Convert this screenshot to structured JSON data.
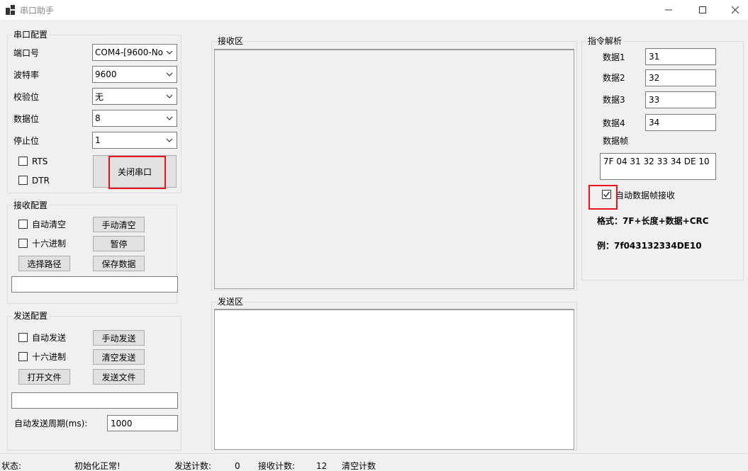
{
  "window": {
    "title": "串口助手",
    "app_icon": "app-grid-icon"
  },
  "serial_config": {
    "title": "串口配置",
    "port_label": "端口号",
    "port_value": "COM4-[9600-No",
    "baud_label": "波特率",
    "baud_value": "9600",
    "parity_label": "校验位",
    "parity_value": "无",
    "databits_label": "数据位",
    "databits_value": "8",
    "stopbits_label": "停止位",
    "stopbits_value": "1",
    "rts_label": "RTS",
    "dtr_label": "DTR",
    "close_port_label": "关闭串口"
  },
  "receive_config": {
    "title": "接收配置",
    "auto_clear_label": "自动清空",
    "manual_clear_label": "手动清空",
    "hex_label": "十六进制",
    "pause_label": "暂停",
    "select_path_label": "选择路径",
    "save_data_label": "保存数据",
    "path_value": ""
  },
  "send_config": {
    "title": "发送配置",
    "auto_send_label": "自动发送",
    "manual_send_label": "手动发送",
    "hex_label": "十六进制",
    "clear_send_label": "清空发送",
    "open_file_label": "打开文件",
    "send_file_label": "发送文件",
    "file_value": "",
    "period_label": "自动发送周期(ms):",
    "period_value": "1000"
  },
  "receive_area": {
    "title": "接收区",
    "content": ""
  },
  "send_area": {
    "title": "发送区",
    "content": ""
  },
  "command_parse": {
    "title": "指令解析",
    "data1_label": "数据1",
    "data1_value": "31",
    "data2_label": "数据2",
    "data2_value": "32",
    "data3_label": "数据3",
    "data3_value": "33",
    "data4_label": "数据4",
    "data4_value": "34",
    "frame_label": "数据帧",
    "frame_value": "7F 04 31 32 33 34 DE 10",
    "auto_receive_label": "自动数据帧接收",
    "auto_receive_checked": true,
    "format_text": "格式：7F+长度+数据+CRC",
    "example_text": "例：7f043132334DE10"
  },
  "status_bar": {
    "status_label": "状态:",
    "status_value": "初始化正常!",
    "send_count_label": "发送计数:",
    "send_count_value": "0",
    "recv_count_label": "接收计数:",
    "recv_count_value": "12",
    "clear_count_label": "清空计数"
  },
  "colors": {
    "highlight": "#e8141e",
    "window_bg": "#f0f0f0"
  }
}
